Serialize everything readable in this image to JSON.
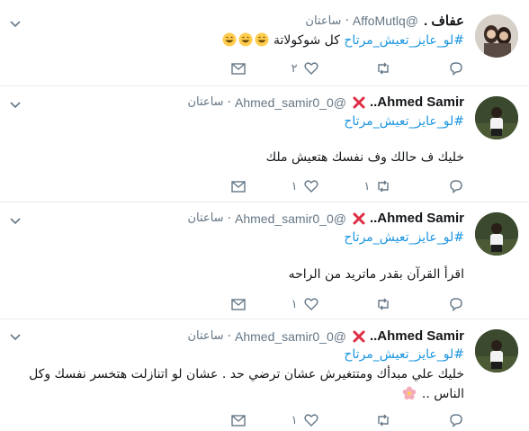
{
  "tweets": [
    {
      "name": "عفاف .",
      "handle": "@AffoMutlq",
      "time": "ساعتان",
      "hashtag": "#لو_عايز_تعيش_مرتاح",
      "inline_text": "كل شوكولاتة",
      "body": "",
      "retweets": "",
      "likes": "٢",
      "emoji_count": 3
    },
    {
      "name": "Ahmed Samir..",
      "handle": "@Ahmed_samir0_0",
      "time": "ساعتان",
      "hashtag": "#لو_عايز_تعيش_مرتاح",
      "body": "خليك ف حالك وف نفسك هتعيش ملك",
      "retweets": "١",
      "likes": "١"
    },
    {
      "name": "Ahmed Samir..",
      "handle": "@Ahmed_samir0_0",
      "time": "ساعتان",
      "hashtag": "#لو_عايز_تعيش_مرتاح",
      "body": "اقرأ القرآن بقدر ماتريد من الراحه",
      "retweets": "",
      "likes": "١"
    },
    {
      "name": "Ahmed Samir..",
      "handle": "@Ahmed_samir0_0",
      "time": "ساعتان",
      "hashtag": "#لو_عايز_تعيش_مرتاح",
      "body": "خليك علي مبدأك ومتتغيرش عشان ترضي حد . عشان لو اتنازلت هتخسر نفسك وكل الناس ..",
      "retweets": "",
      "likes": "١"
    }
  ],
  "colors": {
    "link": "#1b95e0",
    "muted": "#657786",
    "badge": "#dd2e44",
    "border": "#e6ecf0"
  },
  "icons": [
    "chevron-down-icon",
    "reply-icon",
    "retweet-icon",
    "like-icon",
    "message-icon",
    "cross-mark-icon",
    "grinning-emoji-icon",
    "blossom-emoji-icon"
  ]
}
